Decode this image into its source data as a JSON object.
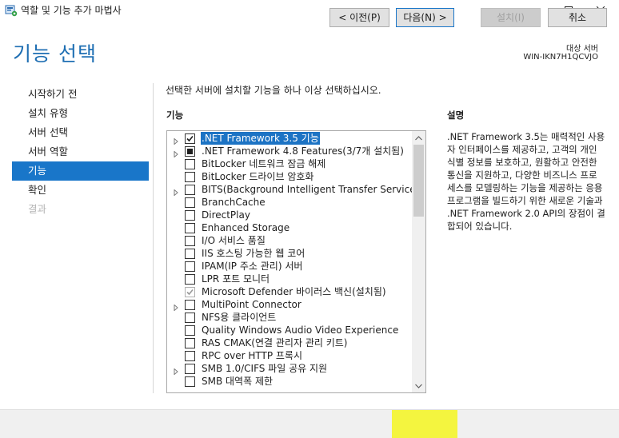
{
  "window": {
    "title": "역할 및 기능 추가 마법사"
  },
  "header": {
    "page_title": "기능 선택",
    "target_label": "대상 서버",
    "target_server": "WIN-IKN7H1QCVJO"
  },
  "nav": {
    "items": [
      {
        "label": "시작하기 전",
        "state": "normal"
      },
      {
        "label": "설치 유형",
        "state": "normal"
      },
      {
        "label": "서버 선택",
        "state": "normal"
      },
      {
        "label": "서버 역할",
        "state": "normal"
      },
      {
        "label": "기능",
        "state": "active"
      },
      {
        "label": "확인",
        "state": "normal"
      },
      {
        "label": "결과",
        "state": "disabled"
      }
    ]
  },
  "main": {
    "instruction": "선택한 서버에 설치할 기능을 하나 이상 선택하십시오.",
    "features_header": "기능",
    "description_header": "설명",
    "description": ".NET Framework 3.5는 매력적인 사용자 인터페이스를 제공하고, 고객의 개인 식별 정보를 보호하고, 원활하고 안전한 통신을 지원하고, 다양한 비즈니스 프로세스를 모델링하는 기능을 제공하는 응용 프로그램을 빌드하기 위한 새로운 기술과 .NET Framework 2.0 API의 장점이 결합되어 있습니다.",
    "features": [
      {
        "label": ".NET Framework 3.5 기능",
        "expandable": true,
        "check": "checked",
        "selected": true
      },
      {
        "label": ".NET Framework 4.8 Features(3/7개 설치됨)",
        "expandable": true,
        "check": "partial",
        "selected": false
      },
      {
        "label": "BitLocker 네트워크 잠금 해제",
        "expandable": false,
        "check": "none",
        "selected": false
      },
      {
        "label": "BitLocker 드라이브 암호화",
        "expandable": false,
        "check": "none",
        "selected": false
      },
      {
        "label": "BITS(Background Intelligent Transfer Service)",
        "expandable": true,
        "check": "none",
        "selected": false
      },
      {
        "label": "BranchCache",
        "expandable": false,
        "check": "none",
        "selected": false
      },
      {
        "label": "DirectPlay",
        "expandable": false,
        "check": "none",
        "selected": false
      },
      {
        "label": "Enhanced Storage",
        "expandable": false,
        "check": "none",
        "selected": false
      },
      {
        "label": "I/O 서비스 품질",
        "expandable": false,
        "check": "none",
        "selected": false
      },
      {
        "label": "IIS 호스팅 가능한 웹 코어",
        "expandable": false,
        "check": "none",
        "selected": false
      },
      {
        "label": "IPAM(IP 주소 관리) 서버",
        "expandable": false,
        "check": "none",
        "selected": false
      },
      {
        "label": "LPR 포트 모니터",
        "expandable": false,
        "check": "none",
        "selected": false
      },
      {
        "label": "Microsoft Defender 바이러스 백신(설치됨)",
        "expandable": false,
        "check": "installed",
        "selected": false
      },
      {
        "label": "MultiPoint Connector",
        "expandable": true,
        "check": "none",
        "selected": false
      },
      {
        "label": "NFS용 클라이언트",
        "expandable": false,
        "check": "none",
        "selected": false
      },
      {
        "label": "Quality Windows Audio Video Experience",
        "expandable": false,
        "check": "none",
        "selected": false
      },
      {
        "label": "RAS CMAK(연결 관리자 관리 키트)",
        "expandable": false,
        "check": "none",
        "selected": false
      },
      {
        "label": "RPC over HTTP 프록시",
        "expandable": false,
        "check": "none",
        "selected": false
      },
      {
        "label": "SMB 1.0/CIFS 파일 공유 지원",
        "expandable": true,
        "check": "none",
        "selected": false
      },
      {
        "label": "SMB 대역폭 제한",
        "expandable": false,
        "check": "none",
        "selected": false
      }
    ]
  },
  "footer": {
    "prev_label": "< 이전(P)",
    "next_label": "다음(N) >",
    "install_label": "설치(I)",
    "cancel_label": "취소"
  },
  "colors": {
    "accent": "#1976c9",
    "title_blue": "#1f6fb3",
    "highlight": "#f4f53f"
  }
}
